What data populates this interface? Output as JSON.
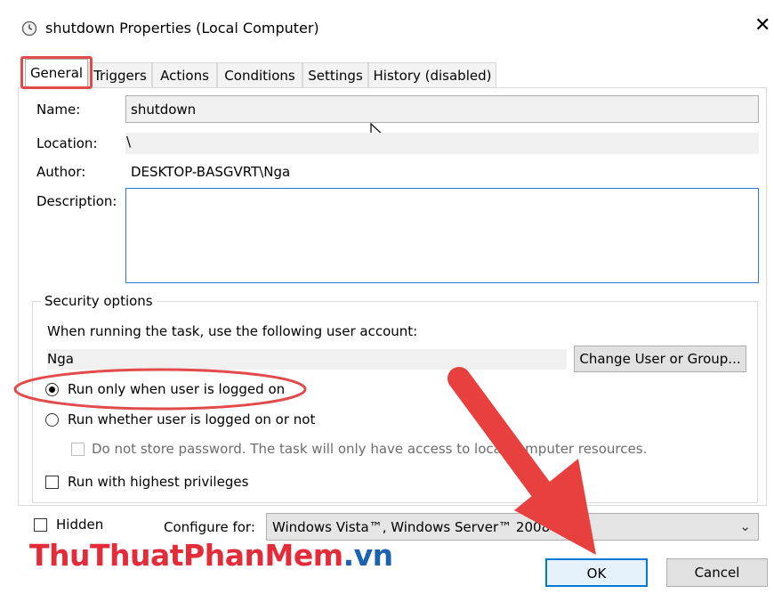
{
  "window": {
    "title": "shutdown Properties (Local Computer)"
  },
  "tabs": [
    "General",
    "Triggers",
    "Actions",
    "Conditions",
    "Settings",
    "History (disabled)"
  ],
  "general": {
    "name_label": "Name:",
    "name_value": "shutdown",
    "location_label": "Location:",
    "location_value": "\\",
    "author_label": "Author:",
    "author_value": "DESKTOP-BASGVRT\\Nga",
    "description_label": "Description:",
    "description_value": ""
  },
  "security": {
    "group_label": "Security options",
    "account_prompt": "When running the task, use the following user account:",
    "user_account": "Nga",
    "change_button": "Change User or Group...",
    "radio_logged_on": "Run only when user is logged on",
    "radio_whether": "Run whether user is logged on or not",
    "do_not_store": "Do not store password.  The task will only have access to local computer resources.",
    "highest_privileges": "Run with highest privileges"
  },
  "footer": {
    "hidden_label": "Hidden",
    "configure_label": "Configure for:",
    "configure_value": "Windows Vista™, Windows Server™ 2008",
    "ok_button": "OK",
    "cancel_button": "Cancel"
  },
  "watermark": {
    "part1": "ThuThuat",
    "part2": "PhanMem",
    "part3": ".vn"
  },
  "colors": {
    "annotation_red": "#e24b4b",
    "focus_blue": "#0078d7"
  },
  "state": {
    "active_tab": "General",
    "selected_radio": "Run only when user is logged on"
  }
}
